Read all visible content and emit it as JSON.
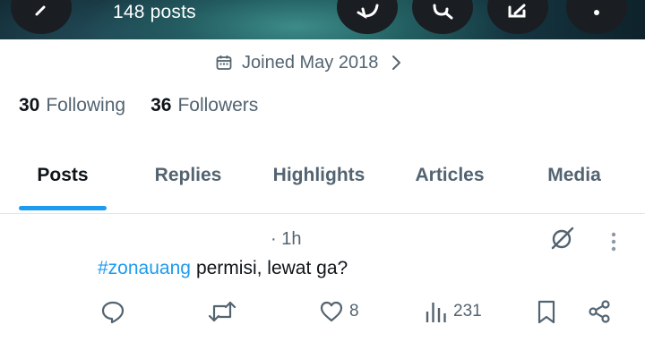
{
  "header": {
    "post_count": "148 posts",
    "buttons": [
      "back-icon",
      "refresh-icon",
      "search-icon",
      "edit-icon",
      "more-icon"
    ]
  },
  "profile": {
    "joined": "Joined May 2018",
    "following_count": "30",
    "following_label": "Following",
    "followers_count": "36",
    "followers_label": "Followers"
  },
  "tabs": [
    {
      "label": "Posts",
      "active": true
    },
    {
      "label": "Replies",
      "active": false
    },
    {
      "label": "Highlights",
      "active": false
    },
    {
      "label": "Articles",
      "active": false
    },
    {
      "label": "Media",
      "active": false
    }
  ],
  "tweet": {
    "time": "· 1h",
    "hashtag": "#zonauang",
    "text": "permisi, lewat ga?",
    "likes": "8",
    "views": "231"
  },
  "colors": {
    "accent": "#1d9bf0",
    "secondary_text": "#536471",
    "primary_text": "#0f1419"
  }
}
